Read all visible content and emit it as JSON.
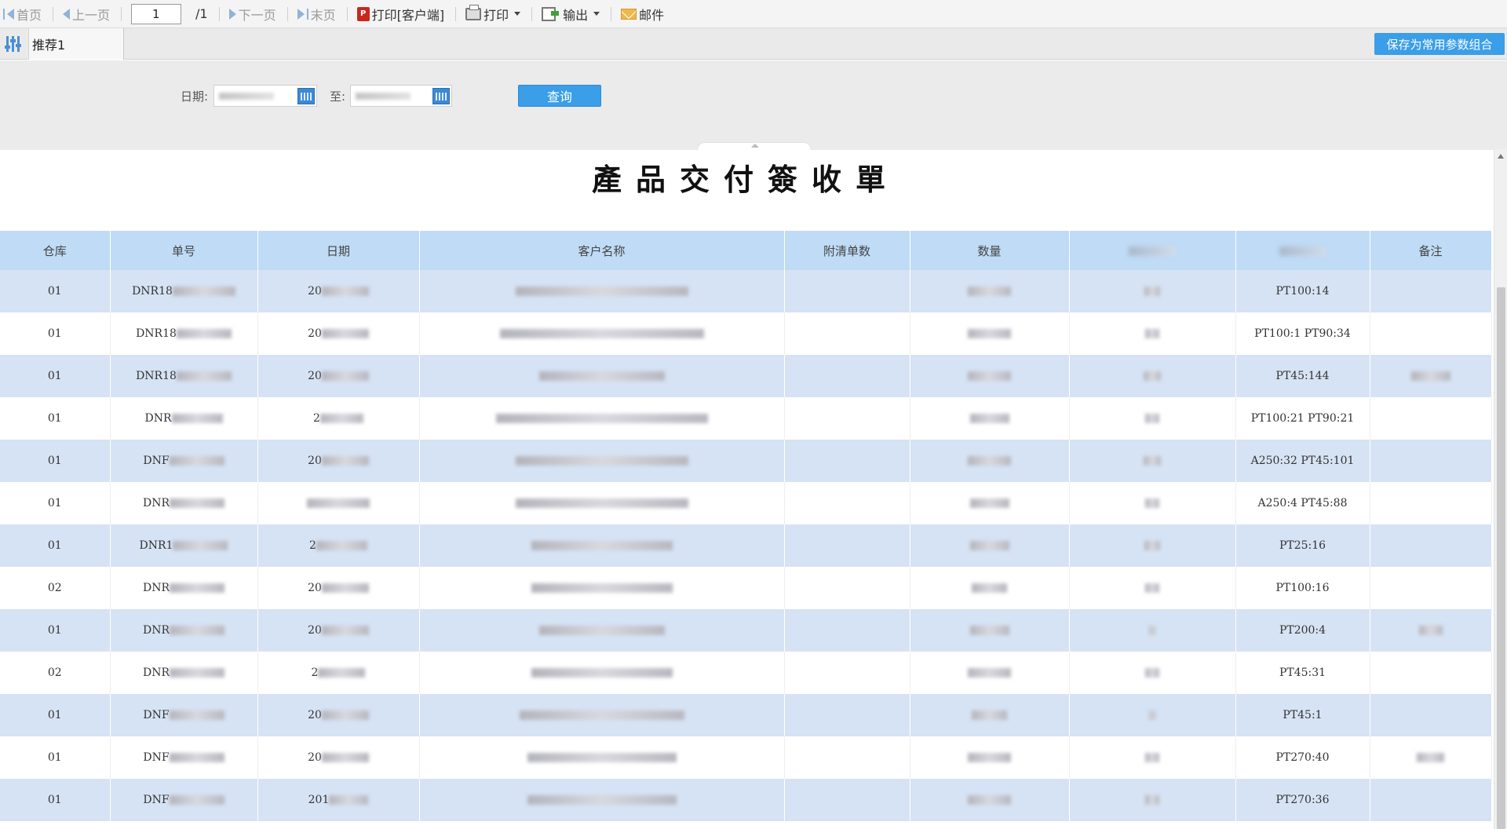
{
  "toolbar": {
    "first": "首页",
    "prev": "上一页",
    "page_value": "1",
    "page_total": "/1",
    "next": "下一页",
    "last": "末页",
    "print_client": "打印[客户端]",
    "print": "打印",
    "export": "输出",
    "mail": "邮件"
  },
  "params": {
    "tab_label": "推荐1",
    "save_button": "保存为常用参数组合"
  },
  "query": {
    "date_label": "日期:",
    "to_label": "至:",
    "query_button": "查询"
  },
  "report": {
    "title": "產品交付簽收單",
    "columns": [
      "仓库",
      "单号",
      "日期",
      "客户名称",
      "附清单数",
      "数量",
      "",
      "",
      "备注"
    ],
    "rows": [
      {
        "warehouse": "01",
        "no_prefix": "DNR18",
        "date_prefix": "20",
        "spec": "PT100:14"
      },
      {
        "warehouse": "01",
        "no_prefix": "DNR18",
        "date_prefix": "20",
        "spec": "PT100:1 PT90:34"
      },
      {
        "warehouse": "01",
        "no_prefix": "DNR18",
        "date_prefix": "20",
        "spec": "PT45:144"
      },
      {
        "warehouse": "01",
        "no_prefix": "DNR",
        "date_prefix": "2",
        "spec": "PT100:21 PT90:21"
      },
      {
        "warehouse": "01",
        "no_prefix": "DNF",
        "date_prefix": "20",
        "spec": "A250:32 PT45:101"
      },
      {
        "warehouse": "01",
        "no_prefix": "DNR",
        "date_prefix": "",
        "spec": "A250:4 PT45:88"
      },
      {
        "warehouse": "01",
        "no_prefix": "DNR1",
        "date_prefix": "2",
        "spec": "PT25:16"
      },
      {
        "warehouse": "02",
        "no_prefix": "DNR",
        "date_prefix": "20",
        "spec": "PT100:16"
      },
      {
        "warehouse": "01",
        "no_prefix": "DNR",
        "date_prefix": "20",
        "spec": "PT200:4"
      },
      {
        "warehouse": "02",
        "no_prefix": "DNR",
        "date_prefix": "2",
        "spec": "PT45:31"
      },
      {
        "warehouse": "01",
        "no_prefix": "DNF",
        "date_prefix": "20",
        "spec": "PT45:1"
      },
      {
        "warehouse": "01",
        "no_prefix": "DNF",
        "date_prefix": "20",
        "spec": "PT270:40"
      },
      {
        "warehouse": "01",
        "no_prefix": "DNF",
        "date_prefix": "201",
        "spec": "PT270:36"
      }
    ]
  },
  "colors": {
    "accent": "#3a9ee8",
    "header_bg": "#bfdbf6",
    "row_alt_bg": "#d6e3f4"
  }
}
